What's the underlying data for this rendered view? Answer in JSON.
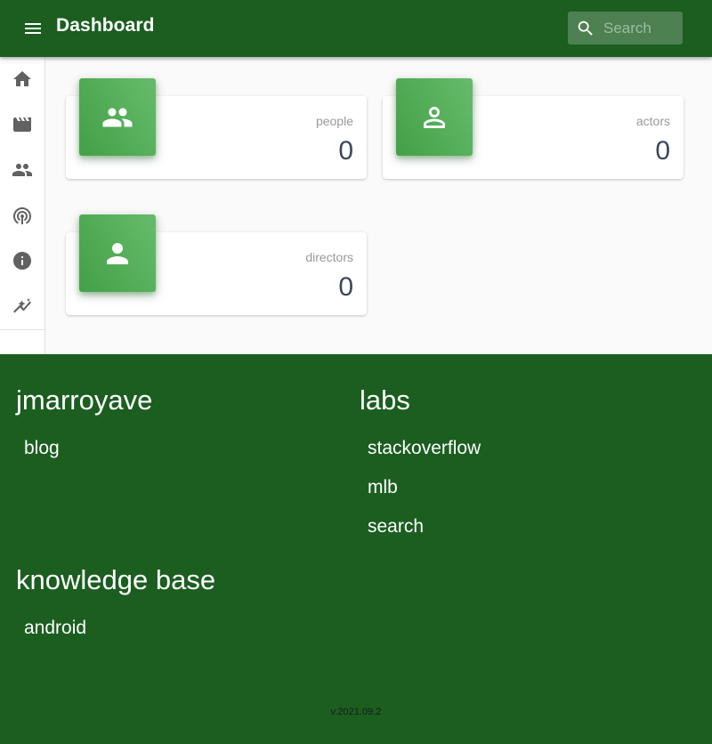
{
  "header": {
    "title": "Dashboard",
    "search_placeholder": "Search",
    "search_value": ""
  },
  "sidebar": {
    "items": [
      {
        "icon": "home-icon"
      },
      {
        "icon": "movie-icon"
      },
      {
        "icon": "people-icon"
      },
      {
        "icon": "podcast-icon"
      },
      {
        "icon": "info-icon"
      },
      {
        "icon": "trending-icon"
      }
    ]
  },
  "cards": [
    {
      "label": "people",
      "value": "0",
      "icon": "people-icon"
    },
    {
      "label": "actors",
      "value": "0",
      "icon": "person-outline-icon"
    },
    {
      "label": "directors",
      "value": "0",
      "icon": "person-icon"
    }
  ],
  "footer": {
    "sections": [
      {
        "heading": "jmarroyave",
        "links": [
          "blog"
        ]
      },
      {
        "heading": "labs",
        "links": [
          "stackoverflow",
          "mlb",
          "search"
        ]
      },
      {
        "heading": "knowledge base",
        "links": [
          "android"
        ]
      }
    ],
    "version": "v.2021.09.2"
  },
  "colors": {
    "primary": "#1b5e20",
    "card_icon": "#4caf50",
    "icon_gray": "#616161"
  }
}
